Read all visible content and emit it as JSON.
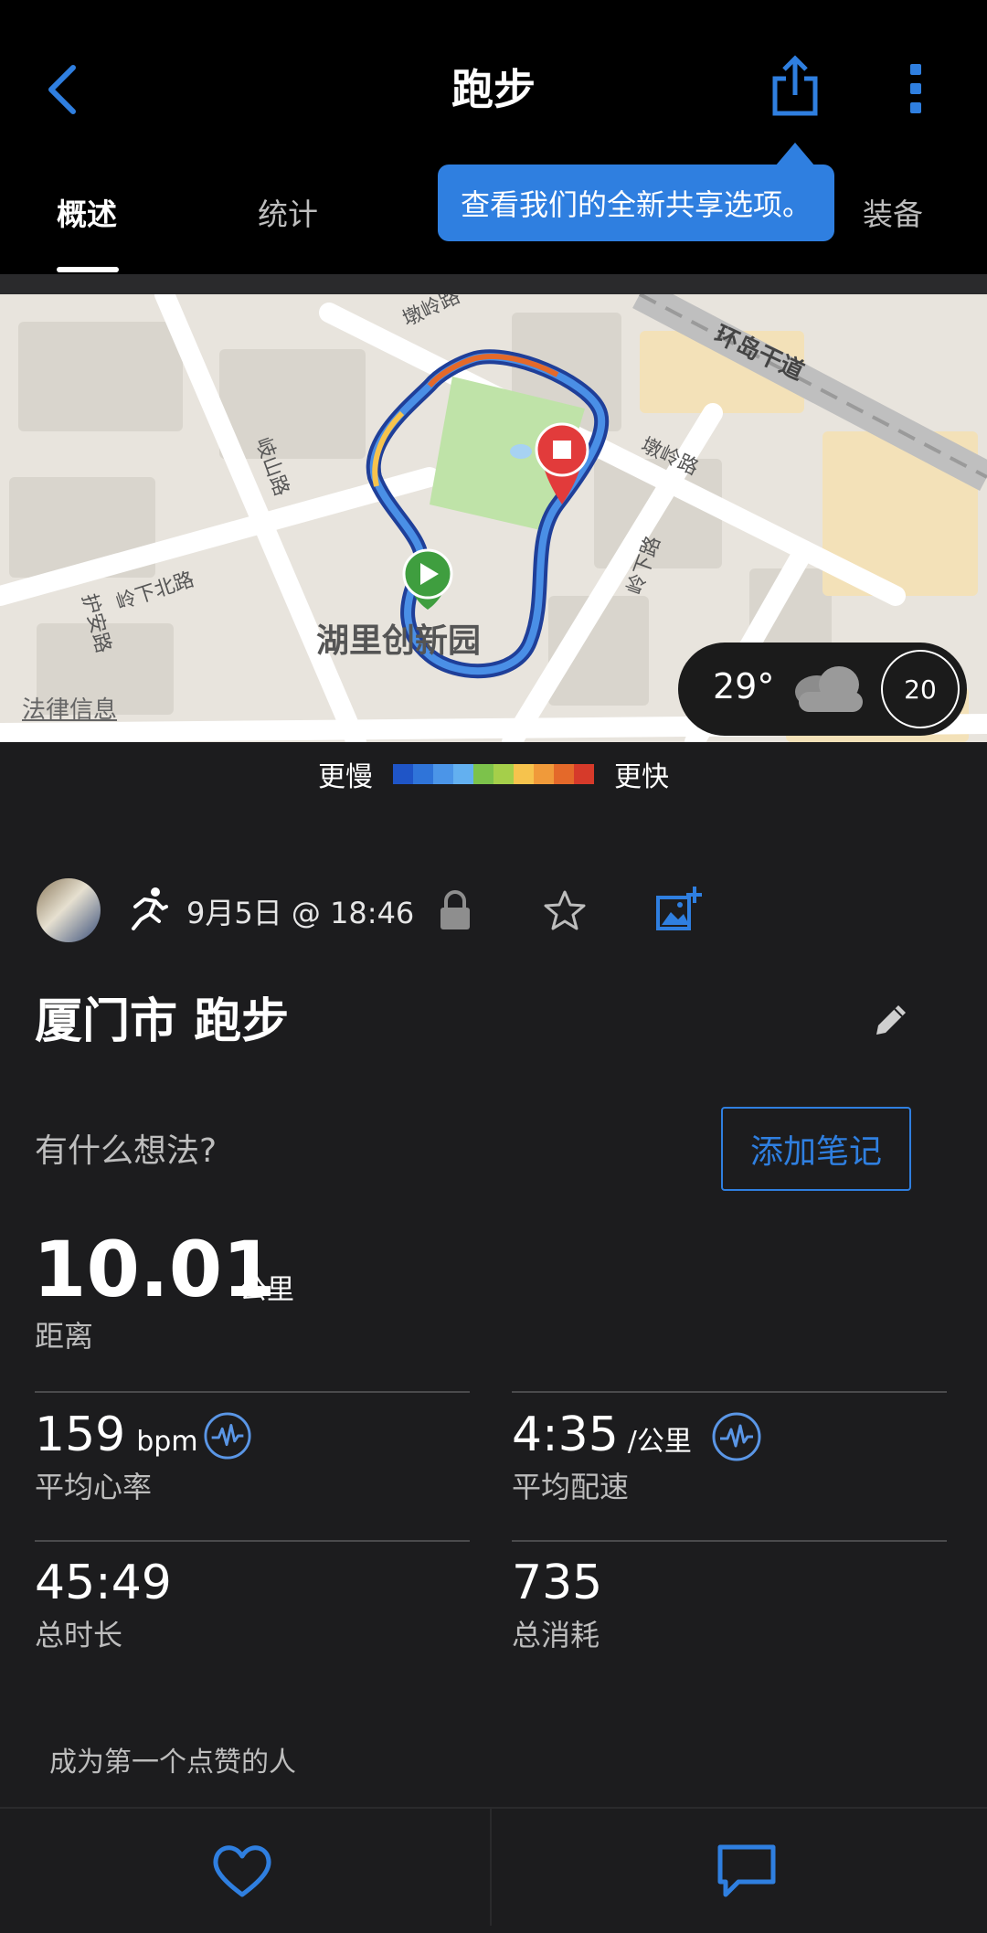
{
  "header": {
    "title": "跑步",
    "tabs": [
      {
        "label": "概述",
        "active": true
      },
      {
        "label": "统计",
        "active": false
      },
      {
        "label": "装备",
        "active": false
      }
    ],
    "tooltip": "查看我们的全新共享选项。"
  },
  "map": {
    "place_label": "湖里创新园",
    "street_labels": [
      "墩岭路",
      "环岛干道",
      "岐山路",
      "岭下北路",
      "护安路",
      "墩岭路",
      "岭下路"
    ],
    "legal": "法律信息",
    "weather": {
      "temp": "29°",
      "wind": "20"
    }
  },
  "legend": {
    "slower": "更慢",
    "faster": "更快",
    "colors": [
      "#1f55c7",
      "#2f74d9",
      "#4b95e8",
      "#63b0f0",
      "#7cc24b",
      "#a5cf4a",
      "#f6c34d",
      "#f09a3a",
      "#e4692a",
      "#d63a2a"
    ]
  },
  "activity": {
    "date": "9月5日 @ 18:46",
    "title": "厦门市 跑步",
    "note_prompt": "有什么想法?",
    "note_button": "添加笔记"
  },
  "stats": {
    "distance": {
      "value": "10.01",
      "unit": "公里",
      "label": "距离"
    },
    "heart_rate": {
      "value": "159",
      "unit": "bpm",
      "label": "平均心率"
    },
    "pace": {
      "value": "4:35",
      "unit": "/公里",
      "label": "平均配速"
    },
    "duration": {
      "value": "45:49",
      "label": "总时长"
    },
    "calories": {
      "value": "735",
      "label": "总消耗"
    }
  },
  "social": {
    "likes_text": "成为第一个点赞的人"
  },
  "icons": {
    "back": "back-chevron-icon",
    "share": "share-icon",
    "more": "more-vertical-icon",
    "run": "running-person-icon",
    "lock": "lock-icon",
    "star": "star-icon",
    "add_photo": "add-photo-icon",
    "edit": "pencil-icon",
    "pulse": "activity-pulse-icon",
    "like": "heart-icon",
    "comment": "comment-icon"
  }
}
